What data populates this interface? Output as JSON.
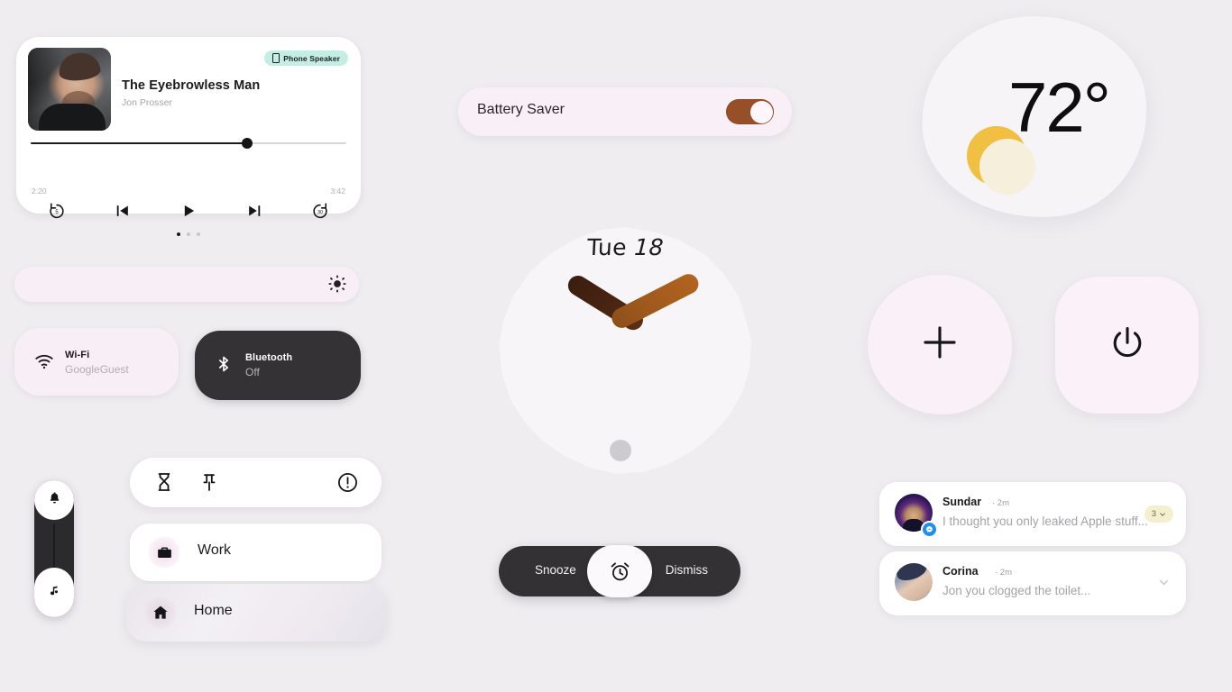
{
  "background_color": "#efedf0",
  "media_player": {
    "track_title": "The Eyebrowless Man",
    "artist": "Jon Prosser",
    "output_badge": "Phone Speaker",
    "output_badge_color": "#c4eee4",
    "time_current": "2:20",
    "time_total": "3:42",
    "progress_percent": 67,
    "controls": {
      "replay": "replay-5-icon",
      "previous": "skip-previous-icon",
      "play": "play-icon",
      "next": "skip-next-icon",
      "forward": "forward-30-icon"
    },
    "page_dots": 3,
    "active_dot": 1
  },
  "brightness": {
    "icon": "brightness-icon",
    "level_percent": 100,
    "bar_color": "#f8eff6"
  },
  "connectivity": {
    "wifi": {
      "title": "Wi-Fi",
      "subtitle": "GoogleGuest",
      "icon": "wifi-icon",
      "state": "on",
      "tile_color": "#f8eff6"
    },
    "bluetooth": {
      "title": "Bluetooth",
      "subtitle": "Off",
      "icon": "bluetooth-icon",
      "state": "off",
      "tile_color": "#343234"
    }
  },
  "volume_slider": {
    "top_icon": "bell-icon",
    "bottom_icon": "music-note-icon",
    "track_color": "#2b2a2c",
    "level_percent": 40
  },
  "quick_row": {
    "icons": [
      "hourglass-icon",
      "pin-icon",
      "alert-circle-icon"
    ]
  },
  "places": {
    "items": [
      {
        "label": "Work",
        "icon": "briefcase-icon",
        "selected": false
      },
      {
        "label": "Home",
        "icon": "home-icon",
        "selected": true
      }
    ]
  },
  "battery_saver": {
    "label": "Battery Saver",
    "enabled": true,
    "toggle_color": "#964f26",
    "tile_color": "#f9f0f7"
  },
  "clock": {
    "day": "Tue ",
    "date_number": "18",
    "hour_hand_color": "#4a2512",
    "minute_hand_color": "#a15a1d",
    "face_color": "#f7f5f8",
    "time_display": "10:08"
  },
  "alarm": {
    "snooze_label": "Snooze",
    "dismiss_label": "Dismiss",
    "knob_icon": "alarm-clock-icon",
    "bar_color": "#333133"
  },
  "weather": {
    "temperature": "72°",
    "condition_icon": "sun-icon",
    "sun_color": "#f1c043",
    "blob_color": "#f6f4f7"
  },
  "actions": {
    "add": {
      "icon": "plus-icon",
      "color": "#faf1f8"
    },
    "power": {
      "icon": "power-icon",
      "color": "#fbf1f9"
    }
  },
  "notifications": [
    {
      "sender": "Sundar",
      "time": "· 2m",
      "message": "I thought you only leaked Apple stuff...",
      "badge_count": "3",
      "badge_color": "#f4efcf",
      "app_icon": "messenger-icon",
      "avatar": "avatar-sundar"
    },
    {
      "sender": "Corina",
      "time": "· 2m",
      "message": "Jon you clogged the toilet...",
      "expand_icon": "chevron-down-icon",
      "avatar": "avatar-corina"
    }
  ]
}
